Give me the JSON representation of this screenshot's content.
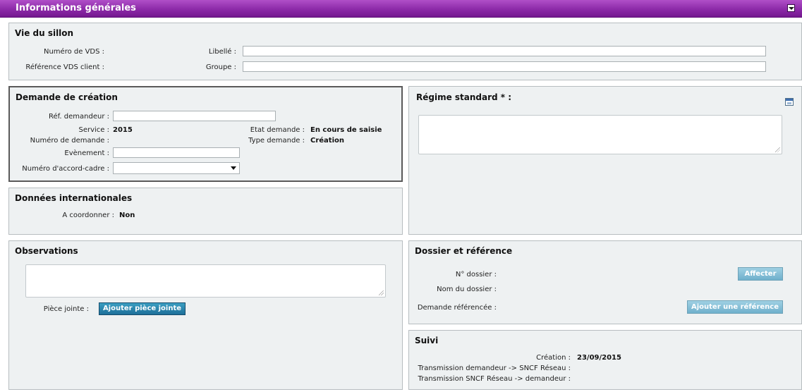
{
  "header": {
    "title": "Informations générales"
  },
  "vie_du_sillon": {
    "title": "Vie du sillon",
    "numero_vds_label": "Numéro de VDS :",
    "reference_vds_label": "Référence VDS client :",
    "libelle_label": "Libellé :",
    "groupe_label": "Groupe :",
    "libelle_value": "",
    "groupe_value": ""
  },
  "demande_creation": {
    "title": "Demande de création",
    "ref_demandeur_label": "Réf. demandeur :",
    "service_label": "Service :",
    "service_value": "2015",
    "numero_demande_label": "Numéro de demande :",
    "evenement_label": "Evènement :",
    "accord_cadre_label": "Numéro d'accord-cadre :",
    "etat_label": "Etat demande :",
    "etat_value": "En cours de saisie",
    "type_label": "Type demande :",
    "type_value": "Création"
  },
  "donnees_internationales": {
    "title": "Données internationales",
    "a_coordonner_label": "A coordonner :",
    "a_coordonner_value": "Non"
  },
  "regime_standard": {
    "title": "Régime standard * :",
    "icon": "calendar-icon"
  },
  "observations": {
    "title": "Observations",
    "piece_jointe_label": "Pièce jointe :",
    "ajouter_piece_label": "Ajouter pièce jointe"
  },
  "dossier_reference": {
    "title": "Dossier et référence",
    "no_dossier_label": "N° dossier :",
    "nom_dossier_label": "Nom du dossier :",
    "demande_referencee_label": "Demande référencée :",
    "affecter_label": "Affecter",
    "ajouter_reference_label": "Ajouter une référence"
  },
  "suivi": {
    "title": "Suivi",
    "creation_label": "Création :",
    "creation_value": "23/09/2015",
    "trans_dem_sncf_label": "Transmission demandeur -> SNCF Réseau :",
    "trans_sncf_dem_label": "Transmission SNCF Réseau -> demandeur :"
  },
  "colors": {
    "header": "#8c2aa8",
    "panel_bg": "#eef1f2",
    "button_blue": "#1d6f99"
  }
}
